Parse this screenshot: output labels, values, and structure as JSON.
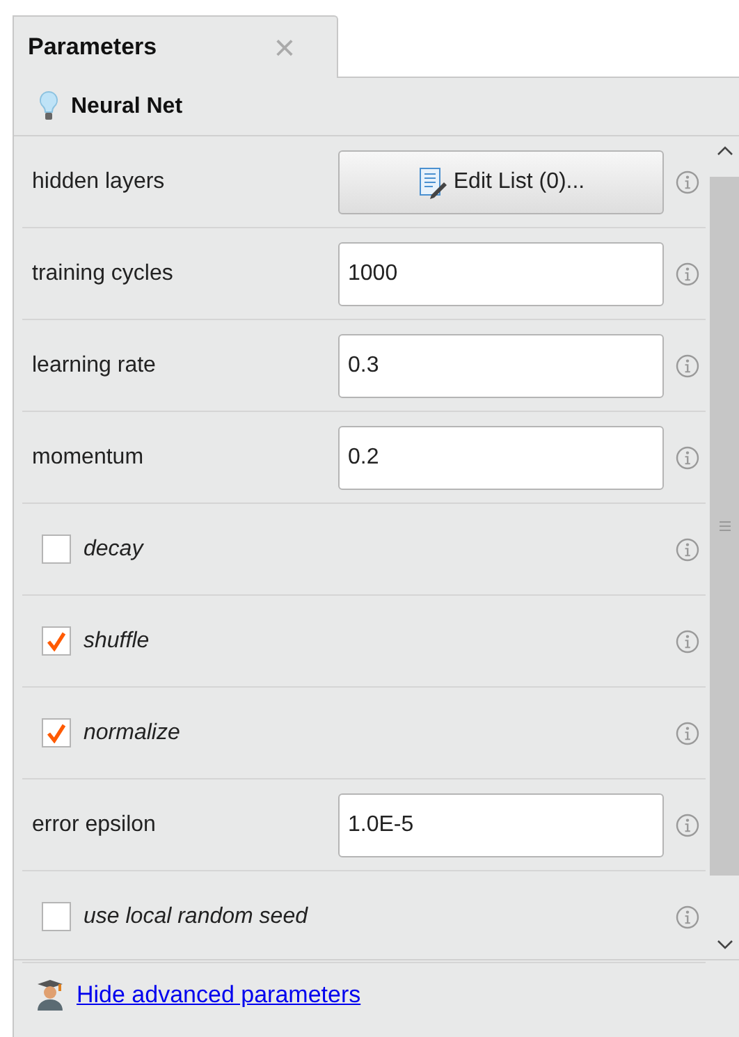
{
  "tab": {
    "label": "Parameters",
    "close": "×"
  },
  "operator": {
    "name": "Neural Net"
  },
  "parameters": [
    {
      "kind": "button",
      "label": "hidden layers",
      "value": "Edit List (0)..."
    },
    {
      "kind": "text",
      "label": "training cycles",
      "value": "1000"
    },
    {
      "kind": "text",
      "label": "learning rate",
      "value": "0.3"
    },
    {
      "kind": "text",
      "label": "momentum",
      "value": "0.2"
    },
    {
      "kind": "checkbox",
      "label": "decay",
      "checked": false
    },
    {
      "kind": "checkbox",
      "label": "shuffle",
      "checked": true
    },
    {
      "kind": "checkbox",
      "label": "normalize",
      "checked": true
    },
    {
      "kind": "text",
      "label": "error epsilon",
      "value": "1.0E-5"
    },
    {
      "kind": "checkbox",
      "label": "use local random seed",
      "checked": false
    }
  ],
  "footer": {
    "link": "Hide advanced parameters"
  }
}
